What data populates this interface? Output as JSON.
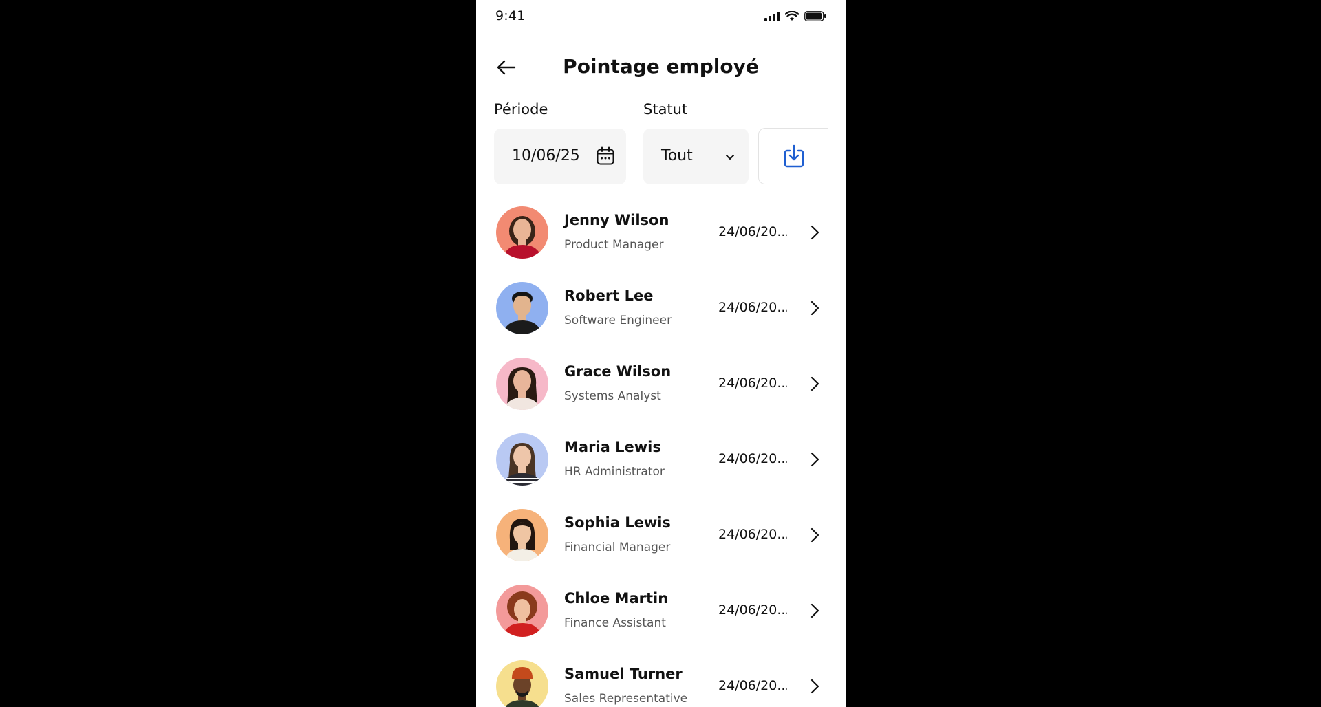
{
  "status_bar": {
    "time": "9:41"
  },
  "header": {
    "title": "Pointage employé",
    "back_icon": "arrow-left-icon"
  },
  "filters": {
    "period_label": "Période",
    "period_value": "10/06/25",
    "status_label": "Statut",
    "status_value": "Tout",
    "download_icon": "download-icon"
  },
  "colors": {
    "accent": "#1f5fd1",
    "text": "#111111",
    "muted": "#555555",
    "field_bg": "#f5f5f5"
  },
  "employees": [
    {
      "name": "Jenny Wilson",
      "role": "Product Manager",
      "date": "24/06/20...",
      "avatar_bg": "#f28a72",
      "skin": "#e9b596",
      "hair": "#3a2418",
      "shirt": "#b8102c"
    },
    {
      "name": "Robert Lee",
      "role": "Software Engineer",
      "date": "24/06/20...",
      "avatar_bg": "#8fb0f0",
      "skin": "#e2b48e",
      "hair": "#141414",
      "shirt": "#1b1b1b"
    },
    {
      "name": "Grace Wilson",
      "role": "Systems Analyst",
      "date": "24/06/20...",
      "avatar_bg": "#f6b8c8",
      "skin": "#e8b59a",
      "hair": "#2a1a12",
      "shirt": "#f1e6e0"
    },
    {
      "name": "Maria Lewis",
      "role": "HR Administrator",
      "date": "24/06/20...",
      "avatar_bg": "#b9c9f3",
      "skin": "#eec6aa",
      "hair": "#4a3424",
      "shirt": "#2b2b33"
    },
    {
      "name": "Sophia Lewis",
      "role": "Financial Manager",
      "date": "24/06/20...",
      "avatar_bg": "#f6b27a",
      "skin": "#efc5a3",
      "hair": "#221610",
      "shirt": "#f3efe6"
    },
    {
      "name": "Chloe Martin",
      "role": "Finance Assistant",
      "date": "24/06/20...",
      "avatar_bg": "#f39a9a",
      "skin": "#efc0a0",
      "hair": "#8a3a1c",
      "shirt": "#d12020"
    },
    {
      "name": "Samuel Turner",
      "role": "Sales Representative",
      "date": "24/06/20...",
      "avatar_bg": "#f6df8e",
      "skin": "#6b4228",
      "hair": "#c44a1c",
      "shirt": "#2f3a2a"
    }
  ]
}
